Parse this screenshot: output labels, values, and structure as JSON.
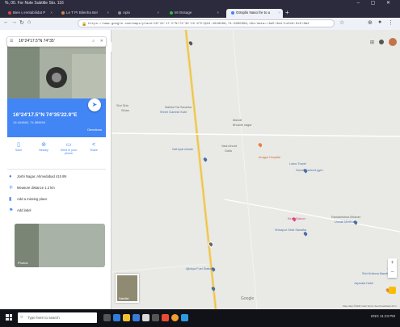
{
  "browser": {
    "window_title": "%, 00. For Note Subtitle Sto. 116",
    "tabs": [
      {
        "label": "Bien  u  rentabilidat  P",
        "active": false
      },
      {
        "label": "Le  T  Pr  Bilenha  Bel",
        "active": false
      },
      {
        "label": "Aplo",
        "active": false
      },
      {
        "label": "M  rtrssage",
        "active": false
      },
      {
        "label": "Gtrsplis Naso fre to u",
        "active": true
      }
    ],
    "new_tab": "+",
    "url": "https://www.google.com/maps/place/16°24'17.5\"N+74°35'22.9\"E/@16.4048598,74.5885096,18z/data=!4m5!3m4!1s0x0:0x0!8m2"
  },
  "sidebar": {
    "search_query": "16°24'17.5\"N 74°35'",
    "place_title": "16°24'17.5\"N 74°35'22.9\"E",
    "place_subtitle": "16.404860, 74.589694",
    "directions_link": "Directions",
    "actions": [
      {
        "label": "Save",
        "icon": "bookmark-icon"
      },
      {
        "label": "Nearby",
        "icon": "nearby-icon"
      },
      {
        "label": "Send to your phone",
        "icon": "phone-icon"
      },
      {
        "label": "Share",
        "icon": "share-icon"
      }
    ],
    "info": [
      {
        "text": "Joshi Nagar, Ahmedabad 415 8N",
        "icon": "location-pin-icon"
      },
      {
        "text": "Measure distance  1.2 km",
        "icon": "ruler-icon"
      },
      {
        "text": "Add a missing place",
        "icon": "add-place-icon"
      },
      {
        "text": "Add label",
        "icon": "flag-icon"
      }
    ],
    "photo_caption": "Photos"
  },
  "map": {
    "labels": [
      {
        "text": "Shri Shiv",
        "color": "grey"
      },
      {
        "text": "Mahila Pat Sanstha",
        "color": "grey"
      },
      {
        "text": "Sthan",
        "color": "grey"
      },
      {
        "text": "Shree Ganesh Kutir",
        "color": "blue"
      },
      {
        "text": "Gurukul school gym",
        "color": "blue"
      },
      {
        "text": "Mandir",
        "color": "grey"
      },
      {
        "text": "Bhukde nagar",
        "color": "grey"
      },
      {
        "text": "Gat kyal chowk",
        "color": "blue"
      },
      {
        "text": "Vadu khurd",
        "color": "grey"
      },
      {
        "text": "Arogya Hospital",
        "color": "orange"
      },
      {
        "text": "Lotus Travel",
        "color": "blue"
      },
      {
        "text": "Galla",
        "color": "blue"
      },
      {
        "text": "Shivapur Ghat Sanstha",
        "color": "blue"
      },
      {
        "text": "Kiran Saloon",
        "color": "grey"
      },
      {
        "text": "Ajinkya Fuel Station",
        "color": "blue"
      },
      {
        "text": "Unnati Medical",
        "color": "blue"
      },
      {
        "text": "Ramakrishna Bhavan",
        "color": "grey"
      },
      {
        "text": "Shri Krishna Mandir",
        "color": "blue"
      },
      {
        "text": "Jaymala Hotel",
        "color": "blue"
      }
    ],
    "satellite_label": "Satellite",
    "zoom_in": "+",
    "zoom_out": "−",
    "google_mark": "Google",
    "attribution": "Map data ©2020  India  Terms  Send feedback  20 m"
  },
  "taskbar": {
    "search_placeholder": "Type here to search",
    "tray": "ENG  11:23  PM"
  }
}
